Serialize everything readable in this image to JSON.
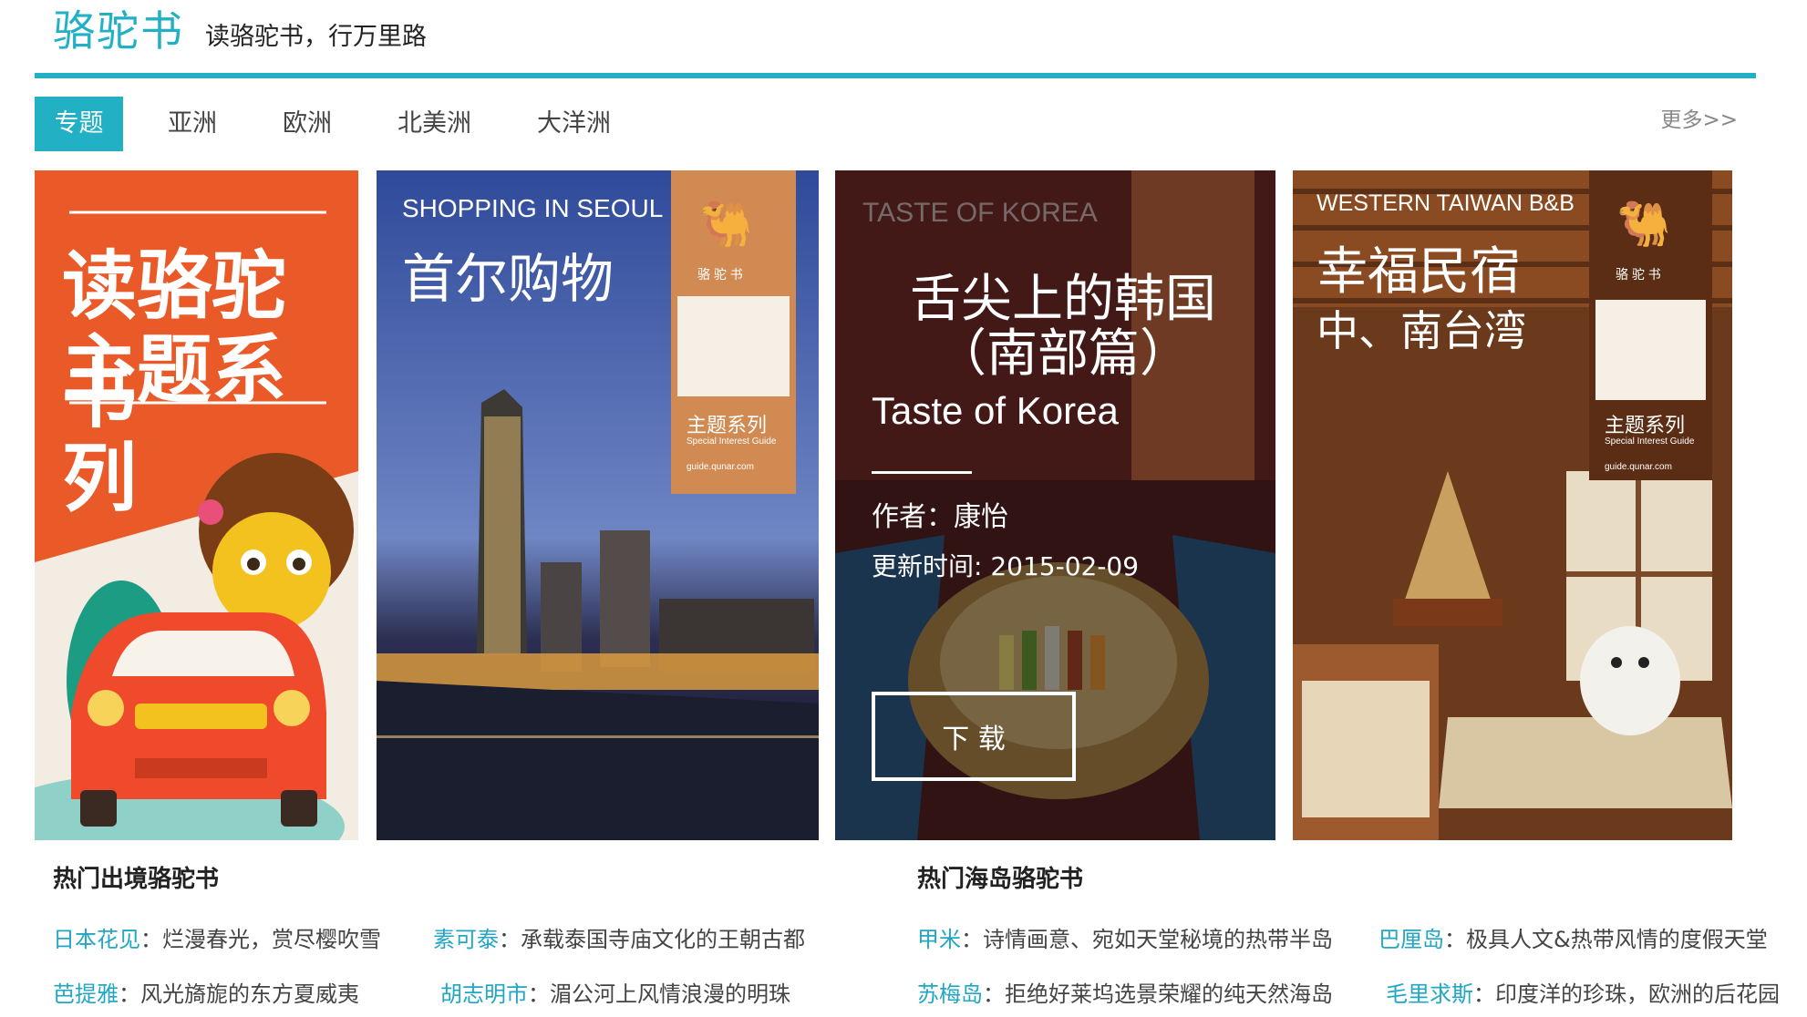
{
  "header": {
    "logo": "骆驼书",
    "slogan": "读骆驼书，行万里路"
  },
  "tabs": [
    {
      "label": "专题",
      "active": true
    },
    {
      "label": "亚洲",
      "active": false
    },
    {
      "label": "欧洲",
      "active": false
    },
    {
      "label": "北美洲",
      "active": false
    },
    {
      "label": "大洋洲",
      "active": false
    }
  ],
  "more_label": "更多>>",
  "accent_color": "#21b0c4",
  "cards": [
    {
      "title_line1": "读骆驼书",
      "title_line2": "主题系列"
    },
    {
      "en_title": "SHOPPING IN SEOUL",
      "zh_title": "首尔购物",
      "brand": "骆 驼 书",
      "series": "主题系列",
      "series_en": "Special Interest Guide",
      "site": "guide.qunar.com"
    },
    {
      "en_title": "TASTE OF KOREA",
      "overlay_zh": "舌尖上的韩国（南部篇）",
      "overlay_en": "Taste of Korea",
      "author": "作者：康怡",
      "updated": "更新时间: 2015-02-09",
      "download": "下 载"
    },
    {
      "en_title": "WESTERN TAIWAN B&B",
      "zh_title_line1": "幸福民宿",
      "zh_title_line2": "中、南台湾",
      "brand": "骆 驼 书",
      "series": "主题系列",
      "series_en": "Special Interest Guide",
      "site": "guide.qunar.com"
    }
  ],
  "sections": [
    {
      "title": "热门出境骆驼书",
      "links": [
        {
          "place": "日本花见",
          "sep": "：",
          "desc": "烂漫春光，赏尽樱吹雪"
        },
        {
          "place": "素可泰",
          "sep": "：",
          "desc": "承载泰国寺庙文化的王朝古都"
        },
        {
          "place": "芭提雅",
          "sep": "：",
          "desc": "风光旖旎的东方夏威夷"
        },
        {
          "place": "胡志明市",
          "sep": "：",
          "desc": "湄公河上风情浪漫的明珠"
        }
      ]
    },
    {
      "title": "热门海岛骆驼书",
      "links": [
        {
          "place": "甲米",
          "sep": "：",
          "desc": "诗情画意、宛如天堂秘境的热带半岛"
        },
        {
          "place": "巴厘岛",
          "sep": "：",
          "desc": "极具人文&热带风情的度假天堂"
        },
        {
          "place": "苏梅岛",
          "sep": "：",
          "desc": "拒绝好莱坞选景荣耀的纯天然海岛"
        },
        {
          "place": "毛里求斯",
          "sep": "：",
          "desc": "印度洋的珍珠，欧洲的后花园"
        }
      ]
    }
  ]
}
